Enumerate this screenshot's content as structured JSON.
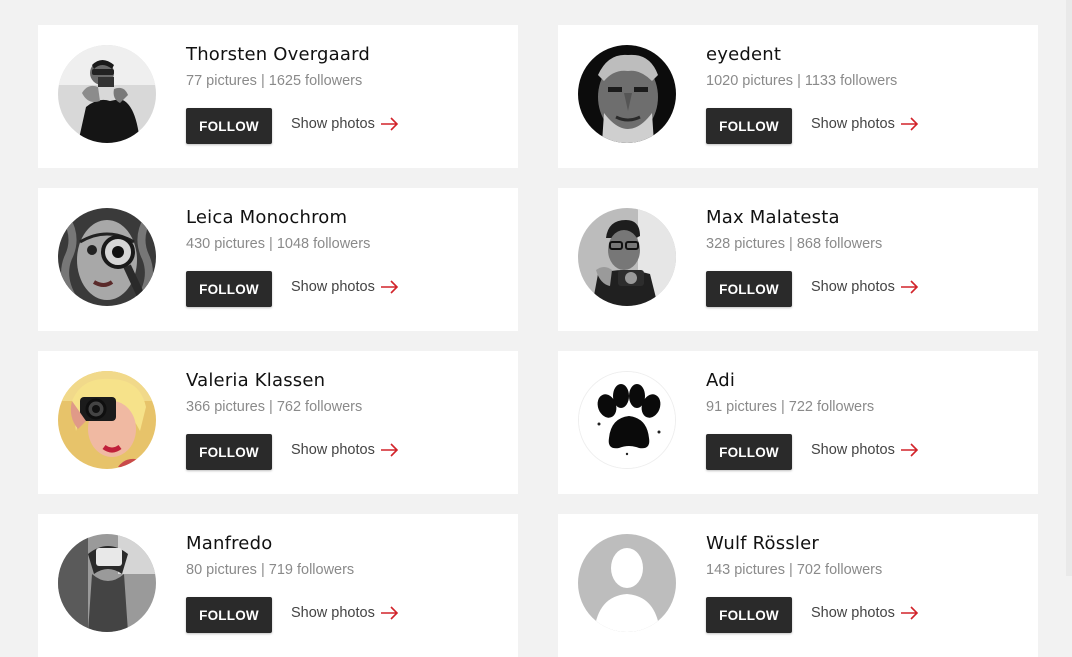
{
  "photographers": [
    {
      "name": "Thorsten Overgaard",
      "stats": "77 pictures | 1625 followers",
      "follow_label": "FOLLOW",
      "show_label": "Show photos",
      "avatar": "bw-photographer-with-camera"
    },
    {
      "name": "eyedent",
      "stats": "1020 pictures | 1133 followers",
      "follow_label": "FOLLOW",
      "show_label": "Show photos",
      "avatar": "bw-bearded-man-portrait"
    },
    {
      "name": "Leica Monochrom",
      "stats": "430 pictures | 1048 followers",
      "follow_label": "FOLLOW",
      "show_label": "Show photos",
      "avatar": "bw-woman-with-magnifier"
    },
    {
      "name": "Max Malatesta",
      "stats": "328 pictures | 868 followers",
      "follow_label": "FOLLOW",
      "show_label": "Show photos",
      "avatar": "bw-man-with-glasses-and-camera"
    },
    {
      "name": "Valeria Klassen",
      "stats": "366 pictures | 762 followers",
      "follow_label": "FOLLOW",
      "show_label": "Show photos",
      "avatar": "color-woman-with-camera"
    },
    {
      "name": "Adi",
      "stats": "91 pictures | 722 followers",
      "follow_label": "FOLLOW",
      "show_label": "Show photos",
      "avatar": "paw-print"
    },
    {
      "name": "Manfredo",
      "stats": "80 pictures | 719 followers",
      "follow_label": "FOLLOW",
      "show_label": "Show photos",
      "avatar": "bw-photo"
    },
    {
      "name": "Wulf Rössler",
      "stats": "143 pictures | 702 followers",
      "follow_label": "FOLLOW",
      "show_label": "Show photos",
      "avatar": "default-silhouette"
    }
  ],
  "colors": {
    "accent_arrow": "#d2232a",
    "button_bg": "#2a2a2a",
    "page_bg": "#f2f2f2"
  }
}
